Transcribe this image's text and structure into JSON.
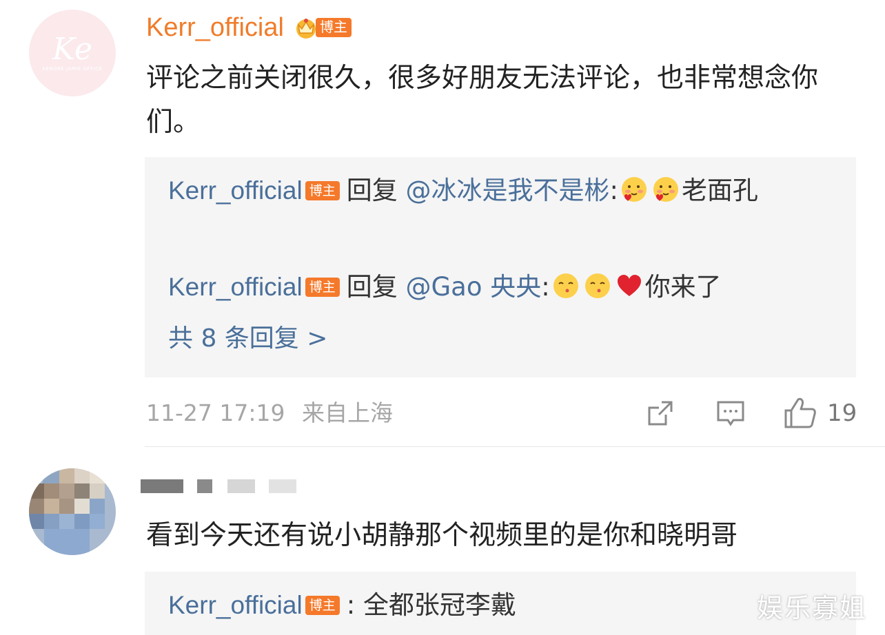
{
  "comments": [
    {
      "username": "Kerr_official",
      "badge": "博主",
      "avatar_text": "Ke",
      "avatar_small": "KENORE.JAMIE.OFFICE",
      "text": "评论之前关闭很久，很多好朋友无法评论，也非常想念你们。",
      "replies": [
        {
          "name": "Kerr_official",
          "badge": "博主",
          "verb": "回复",
          "mention": "@冰冰是我不是彬",
          "colon": ":",
          "emojis": [
            "blush-heart-emoji",
            "blush-heart-emoji"
          ],
          "text": "老面孔"
        },
        {
          "name": "Kerr_official",
          "badge": "博主",
          "verb": "回复",
          "mention": "@Gao 央央",
          "colon": ":",
          "emojis": [
            "kiss-emoji",
            "kiss-emoji",
            "heart-emoji"
          ],
          "text": "你来了"
        }
      ],
      "more_replies": "共 8 条回复 >",
      "timestamp": "11-27 17:19",
      "location": "来自上海",
      "likes": "19",
      "icons": [
        "share-icon",
        "comment-icon",
        "like-icon"
      ]
    },
    {
      "username_blurred": true,
      "text": "看到今天还有说小胡静那个视频里的是你和晓明哥",
      "reply": {
        "name": "Kerr_official",
        "badge": "博主",
        "colon": ":",
        "text": "全都张冠李戴"
      }
    }
  ],
  "watermark": "娱乐寡姐",
  "colors": {
    "username_orange": "#f07c2a",
    "badge_orange": "#f5792a",
    "link_blue": "#4a6f9a",
    "meta_gray": "#a6a6a6",
    "reply_bg": "#f5f5f5"
  }
}
